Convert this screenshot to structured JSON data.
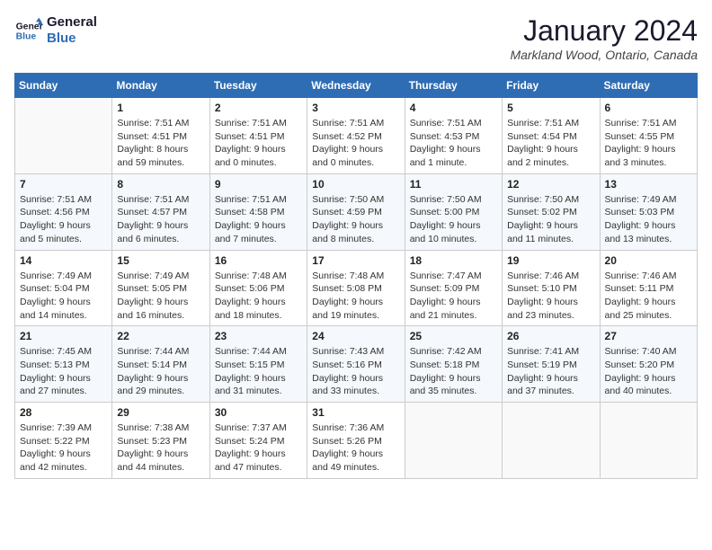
{
  "header": {
    "logo_line1": "General",
    "logo_line2": "Blue",
    "month": "January 2024",
    "location": "Markland Wood, Ontario, Canada"
  },
  "days_of_week": [
    "Sunday",
    "Monday",
    "Tuesday",
    "Wednesday",
    "Thursday",
    "Friday",
    "Saturday"
  ],
  "weeks": [
    [
      {
        "day": "",
        "content": ""
      },
      {
        "day": "1",
        "content": "Sunrise: 7:51 AM\nSunset: 4:51 PM\nDaylight: 8 hours\nand 59 minutes."
      },
      {
        "day": "2",
        "content": "Sunrise: 7:51 AM\nSunset: 4:51 PM\nDaylight: 9 hours\nand 0 minutes."
      },
      {
        "day": "3",
        "content": "Sunrise: 7:51 AM\nSunset: 4:52 PM\nDaylight: 9 hours\nand 0 minutes."
      },
      {
        "day": "4",
        "content": "Sunrise: 7:51 AM\nSunset: 4:53 PM\nDaylight: 9 hours\nand 1 minute."
      },
      {
        "day": "5",
        "content": "Sunrise: 7:51 AM\nSunset: 4:54 PM\nDaylight: 9 hours\nand 2 minutes."
      },
      {
        "day": "6",
        "content": "Sunrise: 7:51 AM\nSunset: 4:55 PM\nDaylight: 9 hours\nand 3 minutes."
      }
    ],
    [
      {
        "day": "7",
        "content": "Sunrise: 7:51 AM\nSunset: 4:56 PM\nDaylight: 9 hours\nand 5 minutes."
      },
      {
        "day": "8",
        "content": "Sunrise: 7:51 AM\nSunset: 4:57 PM\nDaylight: 9 hours\nand 6 minutes."
      },
      {
        "day": "9",
        "content": "Sunrise: 7:51 AM\nSunset: 4:58 PM\nDaylight: 9 hours\nand 7 minutes."
      },
      {
        "day": "10",
        "content": "Sunrise: 7:50 AM\nSunset: 4:59 PM\nDaylight: 9 hours\nand 8 minutes."
      },
      {
        "day": "11",
        "content": "Sunrise: 7:50 AM\nSunset: 5:00 PM\nDaylight: 9 hours\nand 10 minutes."
      },
      {
        "day": "12",
        "content": "Sunrise: 7:50 AM\nSunset: 5:02 PM\nDaylight: 9 hours\nand 11 minutes."
      },
      {
        "day": "13",
        "content": "Sunrise: 7:49 AM\nSunset: 5:03 PM\nDaylight: 9 hours\nand 13 minutes."
      }
    ],
    [
      {
        "day": "14",
        "content": "Sunrise: 7:49 AM\nSunset: 5:04 PM\nDaylight: 9 hours\nand 14 minutes."
      },
      {
        "day": "15",
        "content": "Sunrise: 7:49 AM\nSunset: 5:05 PM\nDaylight: 9 hours\nand 16 minutes."
      },
      {
        "day": "16",
        "content": "Sunrise: 7:48 AM\nSunset: 5:06 PM\nDaylight: 9 hours\nand 18 minutes."
      },
      {
        "day": "17",
        "content": "Sunrise: 7:48 AM\nSunset: 5:08 PM\nDaylight: 9 hours\nand 19 minutes."
      },
      {
        "day": "18",
        "content": "Sunrise: 7:47 AM\nSunset: 5:09 PM\nDaylight: 9 hours\nand 21 minutes."
      },
      {
        "day": "19",
        "content": "Sunrise: 7:46 AM\nSunset: 5:10 PM\nDaylight: 9 hours\nand 23 minutes."
      },
      {
        "day": "20",
        "content": "Sunrise: 7:46 AM\nSunset: 5:11 PM\nDaylight: 9 hours\nand 25 minutes."
      }
    ],
    [
      {
        "day": "21",
        "content": "Sunrise: 7:45 AM\nSunset: 5:13 PM\nDaylight: 9 hours\nand 27 minutes."
      },
      {
        "day": "22",
        "content": "Sunrise: 7:44 AM\nSunset: 5:14 PM\nDaylight: 9 hours\nand 29 minutes."
      },
      {
        "day": "23",
        "content": "Sunrise: 7:44 AM\nSunset: 5:15 PM\nDaylight: 9 hours\nand 31 minutes."
      },
      {
        "day": "24",
        "content": "Sunrise: 7:43 AM\nSunset: 5:16 PM\nDaylight: 9 hours\nand 33 minutes."
      },
      {
        "day": "25",
        "content": "Sunrise: 7:42 AM\nSunset: 5:18 PM\nDaylight: 9 hours\nand 35 minutes."
      },
      {
        "day": "26",
        "content": "Sunrise: 7:41 AM\nSunset: 5:19 PM\nDaylight: 9 hours\nand 37 minutes."
      },
      {
        "day": "27",
        "content": "Sunrise: 7:40 AM\nSunset: 5:20 PM\nDaylight: 9 hours\nand 40 minutes."
      }
    ],
    [
      {
        "day": "28",
        "content": "Sunrise: 7:39 AM\nSunset: 5:22 PM\nDaylight: 9 hours\nand 42 minutes."
      },
      {
        "day": "29",
        "content": "Sunrise: 7:38 AM\nSunset: 5:23 PM\nDaylight: 9 hours\nand 44 minutes."
      },
      {
        "day": "30",
        "content": "Sunrise: 7:37 AM\nSunset: 5:24 PM\nDaylight: 9 hours\nand 47 minutes."
      },
      {
        "day": "31",
        "content": "Sunrise: 7:36 AM\nSunset: 5:26 PM\nDaylight: 9 hours\nand 49 minutes."
      },
      {
        "day": "",
        "content": ""
      },
      {
        "day": "",
        "content": ""
      },
      {
        "day": "",
        "content": ""
      }
    ]
  ]
}
